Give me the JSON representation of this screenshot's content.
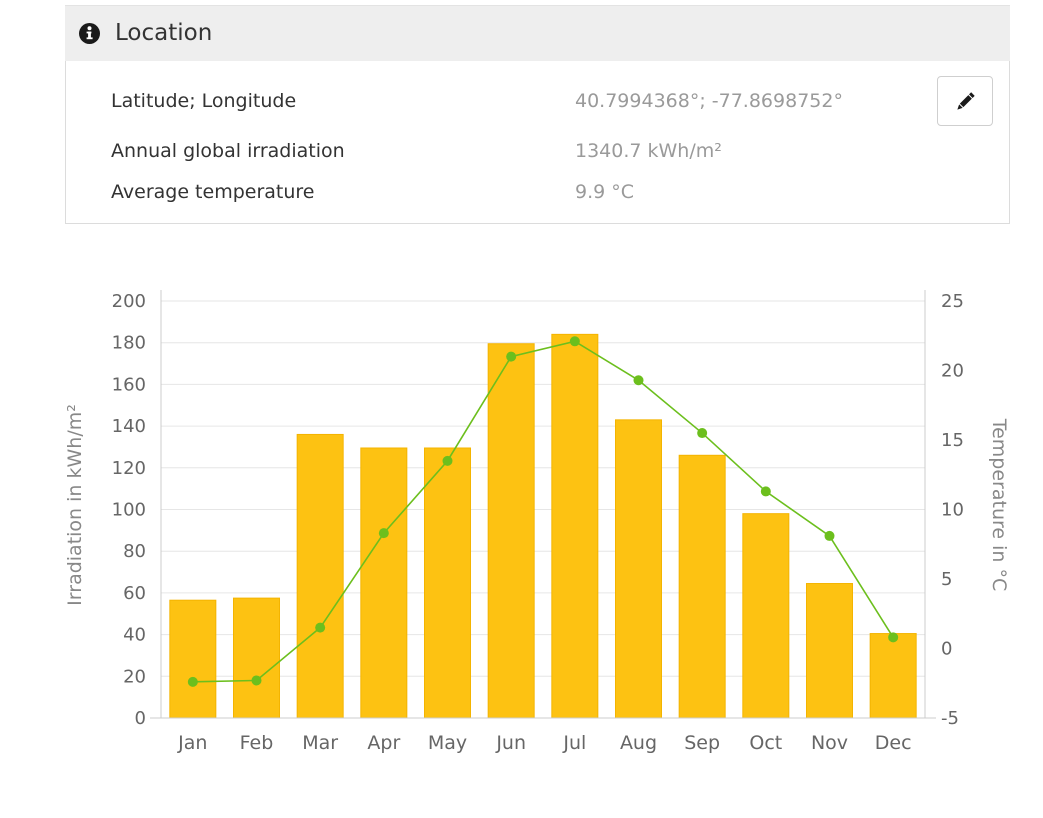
{
  "location_panel": {
    "title": "Location",
    "icon": "info-icon",
    "rows": [
      {
        "label": "Latitude; Longitude",
        "value": "40.7994368°; -77.8698752°"
      },
      {
        "label": "Annual global irradiation",
        "value": "1340.7 kWh/m²"
      },
      {
        "label": "Average temperature",
        "value": "9.9 °C"
      }
    ],
    "edit_icon": "pencil-icon"
  },
  "chart_data": {
    "type": "bar",
    "categories": [
      "Jan",
      "Feb",
      "Mar",
      "Apr",
      "May",
      "Jun",
      "Jul",
      "Aug",
      "Sep",
      "Oct",
      "Nov",
      "Dec"
    ],
    "series": [
      {
        "type": "bar",
        "axis": "left",
        "values": [
          56.5,
          57.5,
          136,
          129.5,
          129.5,
          179.5,
          184,
          143,
          126,
          98,
          64.5,
          40.5
        ],
        "color": "#fdc212"
      },
      {
        "type": "line",
        "axis": "right",
        "values": [
          -2.4,
          -2.3,
          1.5,
          8.3,
          13.5,
          21.0,
          22.1,
          19.3,
          15.5,
          11.3,
          8.1,
          0.8
        ],
        "color": "#6cbf1d"
      }
    ],
    "ylabel": "Irradiation in kWh/m²",
    "y2label": "Temperature in °C",
    "ylim": [
      0,
      200
    ],
    "y2lim": [
      -5,
      25
    ],
    "yticks": [
      "0",
      "20",
      "40",
      "60",
      "80",
      "100",
      "120",
      "140",
      "160",
      "180",
      "200"
    ],
    "y2ticks": [
      "-5",
      "0",
      "5",
      "10",
      "15",
      "20",
      "25"
    ],
    "grid": true
  }
}
